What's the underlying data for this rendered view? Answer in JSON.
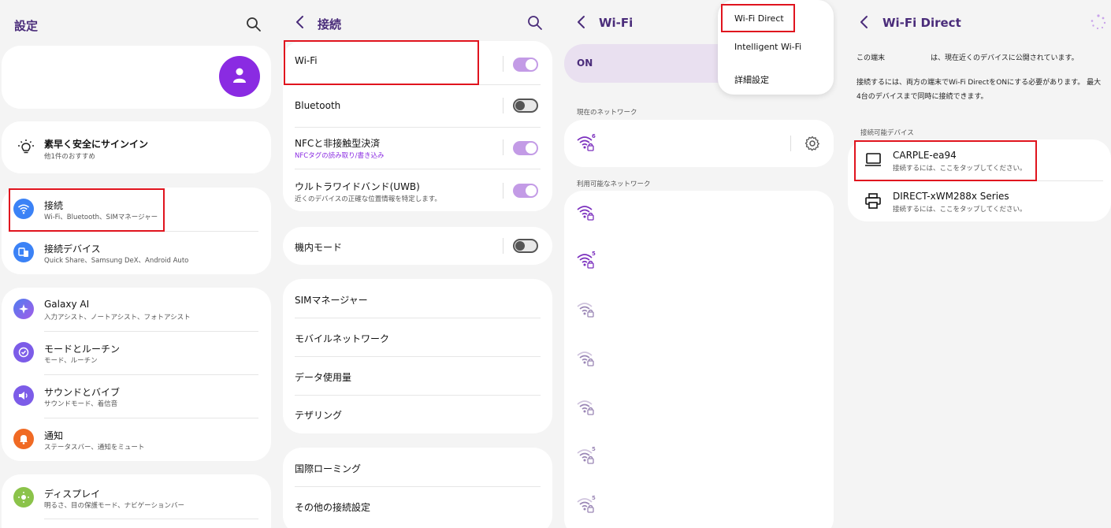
{
  "settings": {
    "title": "設定",
    "suggest": {
      "title": "素早く安全にサインイン",
      "sub": "他1件のおすすめ"
    },
    "items": [
      {
        "title": "接続",
        "sub": "Wi-Fi、Bluetooth、SIMマネージャー"
      },
      {
        "title": "接続デバイス",
        "sub": "Quick Share、Samsung DeX、Android Auto"
      },
      {
        "title": "Galaxy AI",
        "sub": "入力アシスト、ノートアシスト、フォトアシスト"
      },
      {
        "title": "モードとルーチン",
        "sub": "モード、ルーチン"
      },
      {
        "title": "サウンドとバイブ",
        "sub": "サウンドモード、着信音"
      },
      {
        "title": "通知",
        "sub": "ステータスバー、通知をミュート"
      },
      {
        "title": "ディスプレイ",
        "sub": "明るさ、目の保護モード、ナビゲーションバー"
      }
    ]
  },
  "connections": {
    "title": "接続",
    "items": [
      {
        "title": "Wi-Fi",
        "toggle": "on"
      },
      {
        "title": "Bluetooth",
        "toggle": "off"
      },
      {
        "title": "NFCと非接触型決済",
        "sub": "NFCタグの読み取り/書き込み",
        "toggle": "on"
      },
      {
        "title": "ウルトラワイドバンド(UWB)",
        "sub": "近くのデバイスの正確な位置情報を特定します。",
        "toggle": "on"
      },
      {
        "title": "機内モード",
        "toggle": "off"
      },
      {
        "title": "SIMマネージャー"
      },
      {
        "title": "モバイルネットワーク"
      },
      {
        "title": "データ使用量"
      },
      {
        "title": "テザリング"
      },
      {
        "title": "国際ローミング"
      },
      {
        "title": "その他の接続設定"
      }
    ]
  },
  "wifi": {
    "title": "Wi-Fi",
    "on_label": "ON",
    "current_label": "現在のネットワーク",
    "available_label": "利用可能なネットワーク",
    "current_badge": "6",
    "badges": [
      "",
      "5",
      "",
      "",
      "",
      "5",
      "5"
    ],
    "menu": [
      "Wi-Fi Direct",
      "Intelligent Wi-Fi",
      "詳細設定"
    ]
  },
  "wifidirect": {
    "title": "Wi-Fi Direct",
    "device_prefix": "この端末",
    "device_suffix": "は、現在近くのデバイスに公開されています。",
    "info_line1": "接続するには、両方の端末でWi-Fi DirectをONにする必要があります。 最大",
    "info_line2": "4台のデバイスまで同時に接続できます。",
    "available_label": "接続可能デバイス",
    "devices": [
      {
        "name": "CARPLE-ea94",
        "sub": "接続するには、ここをタップしてください。"
      },
      {
        "name": "DIRECT-xWM288x Series",
        "sub": "接続するには、ここをタップしてください。"
      }
    ]
  },
  "colors": {
    "accent": "#7b2fbe",
    "highlight": "#e0141e",
    "toggle_on": "#c39be6"
  }
}
